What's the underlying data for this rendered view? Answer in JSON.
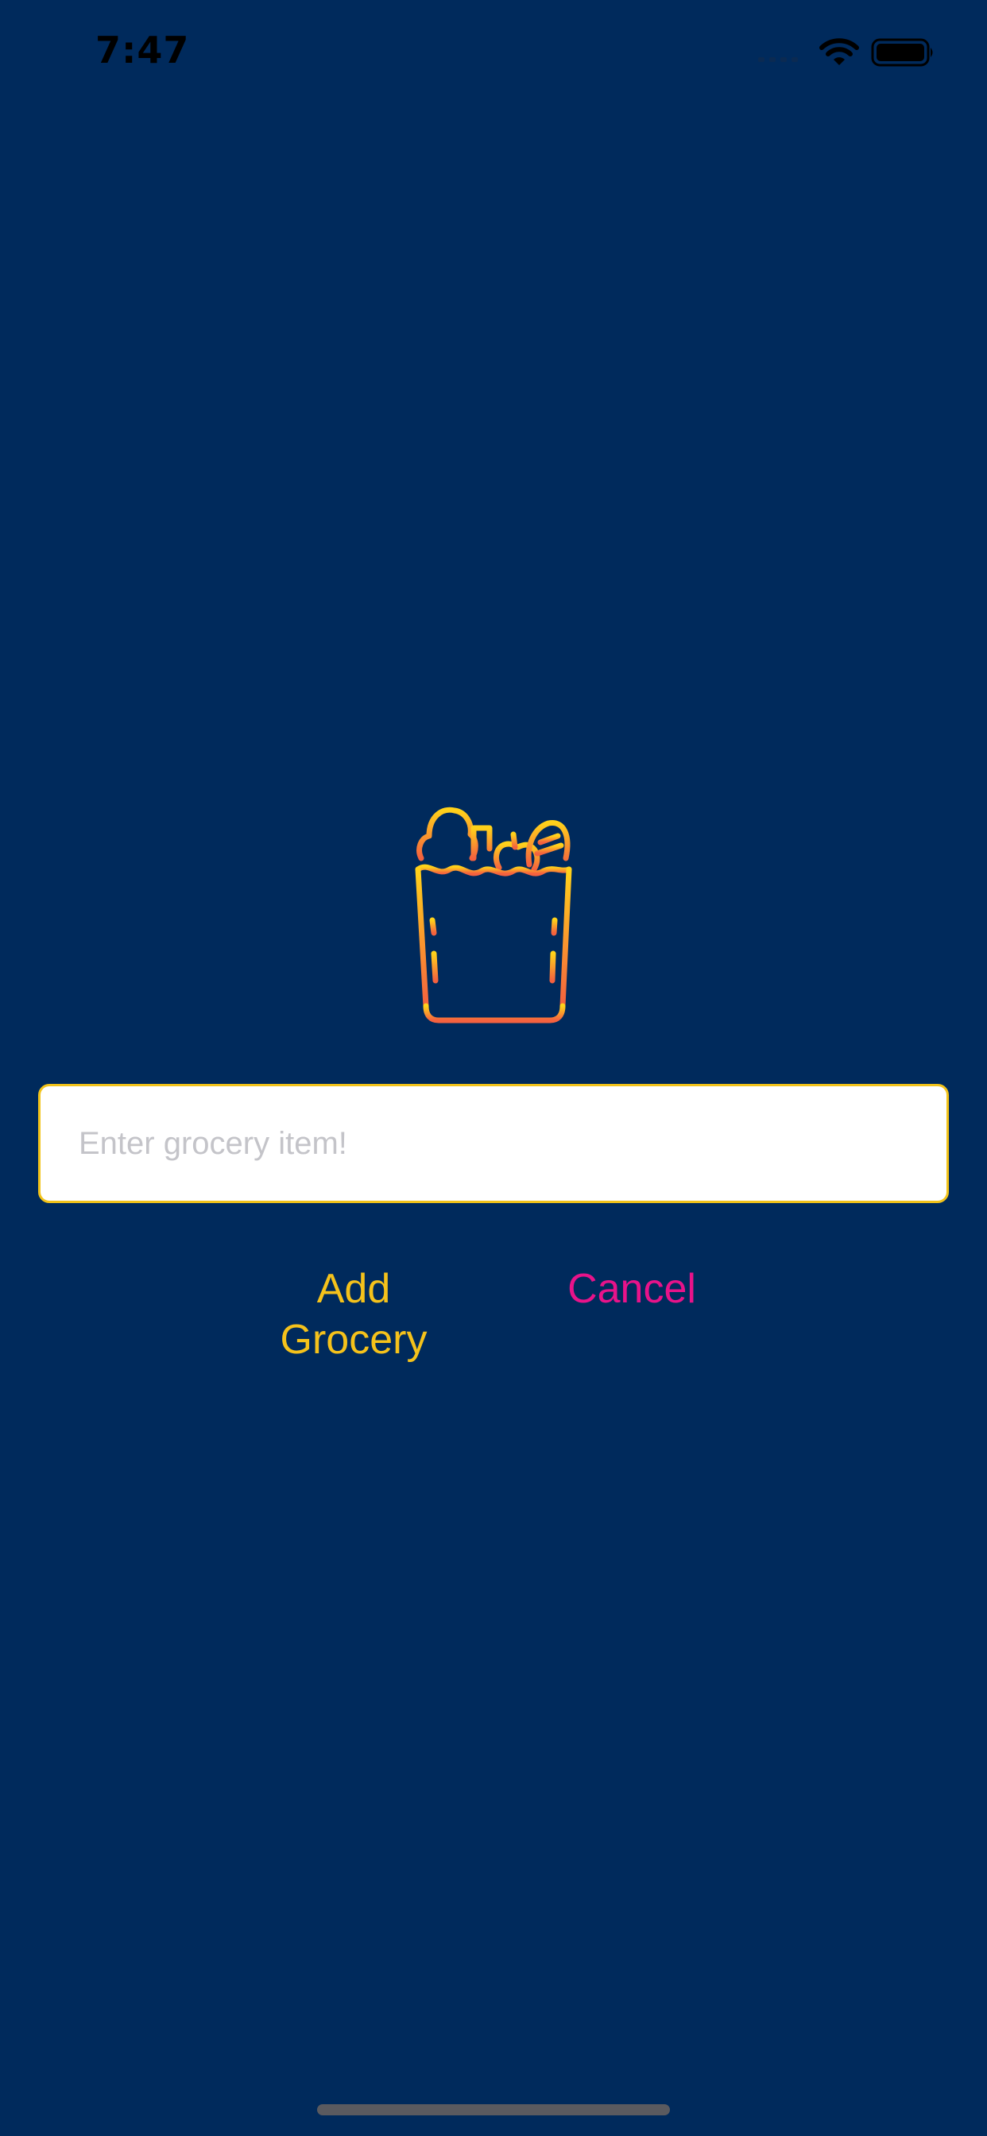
{
  "status_bar": {
    "time": "7:47"
  },
  "form": {
    "input_placeholder": "Enter grocery item!",
    "input_value": "",
    "add_label_line1": "Add",
    "add_label_line2": "Grocery",
    "cancel_label": "Cancel"
  },
  "colors": {
    "background": "#002a5c",
    "accent_yellow": "#f5c21b",
    "accent_pink": "#e8138a",
    "icon_gradient_top": "#ffd21a",
    "icon_gradient_bottom": "#f4613f"
  },
  "icons": {
    "hero": "grocery-bag-icon"
  }
}
